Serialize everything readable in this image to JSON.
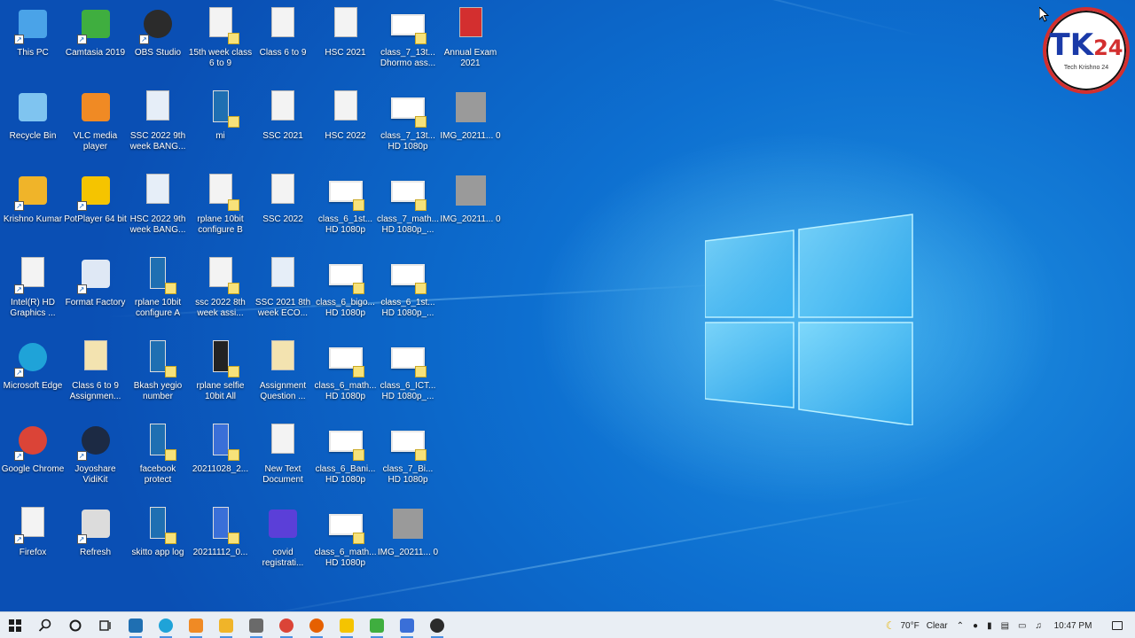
{
  "desktop": {
    "icons": [
      {
        "label": "This PC",
        "icon": "computer-icon",
        "color": "#4aa3e8"
      },
      {
        "label": "Camtasia 2019",
        "icon": "camtasia-icon",
        "color": "#3fae3f"
      },
      {
        "label": "OBS Studio",
        "icon": "obs-icon",
        "color": "#2b2b2b"
      },
      {
        "label": "15th week class 6 to 9",
        "icon": "image-file-icon",
        "color": "#f3f3f3"
      },
      {
        "label": "Class 6 to 9",
        "icon": "blank-file-icon",
        "color": "#f3f3f3"
      },
      {
        "label": "HSC 2021",
        "icon": "blank-file-icon",
        "color": "#f3f3f3"
      },
      {
        "label": "class_7_13t... Dhormo ass...",
        "icon": "video-file-icon",
        "color": "#ffffff"
      },
      {
        "label": "Annual Exam 2021",
        "icon": "pdf-file-icon",
        "color": "#d32f2f"
      },
      {
        "label": "Recycle Bin",
        "icon": "recycle-bin-icon",
        "color": "#7fc4f0"
      },
      {
        "label": "VLC media player",
        "icon": "vlc-icon",
        "color": "#f08a24"
      },
      {
        "label": "SSC 2022 9th week BANG...",
        "icon": "document-icon",
        "color": "#e6eef8"
      },
      {
        "label": "mi",
        "icon": "phone-image-icon",
        "color": "#1f6fb2"
      },
      {
        "label": "SSC 2021",
        "icon": "blank-file-icon",
        "color": "#f3f3f3"
      },
      {
        "label": "HSC 2022",
        "icon": "blank-file-icon",
        "color": "#f3f3f3"
      },
      {
        "label": "class_7_13t... HD 1080p",
        "icon": "video-file-icon",
        "color": "#ffffff"
      },
      {
        "label": "IMG_20211... 0",
        "icon": "photo-icon",
        "color": "#9a9a9a"
      },
      {
        "label": "Krishno Kumar",
        "icon": "user-folder-icon",
        "color": "#f0b429"
      },
      {
        "label": "PotPlayer 64 bit",
        "icon": "potplayer-icon",
        "color": "#f5c400"
      },
      {
        "label": "HSC 2022 9th week BANG...",
        "icon": "document-icon",
        "color": "#e6eef8"
      },
      {
        "label": "rplane 10bit configure B",
        "icon": "image-file-icon",
        "color": "#f3f3f3"
      },
      {
        "label": "SSC 2022",
        "icon": "blank-file-icon",
        "color": "#f3f3f3"
      },
      {
        "label": "class_6_1st... HD 1080p",
        "icon": "video-file-icon",
        "color": "#ffffff"
      },
      {
        "label": "class_7_math... HD 1080p_...",
        "icon": "video-file-icon",
        "color": "#ffffff"
      },
      {
        "label": "IMG_20211... 0",
        "icon": "photo-icon",
        "color": "#9a9a9a"
      },
      {
        "label": "Intel(R) HD Graphics ...",
        "icon": "blank-file-icon",
        "color": "#f3f3f3"
      },
      {
        "label": "Format Factory",
        "icon": "format-factory-icon",
        "color": "#dfe8f5"
      },
      {
        "label": "rplane 10bit configure A",
        "icon": "phone-image-icon",
        "color": "#1f6fb2"
      },
      {
        "label": "ssc 2022 8th week assi...",
        "icon": "image-file-icon",
        "color": "#f3f3f3"
      },
      {
        "label": "SSC 2021 8th week ECO...",
        "icon": "document-icon",
        "color": "#e6eef8"
      },
      {
        "label": "class_6_bigo... HD 1080p",
        "icon": "video-file-icon",
        "color": "#ffffff"
      },
      {
        "label": "class_6_1st... HD 1080p_...",
        "icon": "video-file-icon",
        "color": "#ffffff"
      },
      {
        "label": "Microsoft Edge",
        "icon": "edge-icon",
        "color": "#1fa3d8"
      },
      {
        "label": "Class 6 to 9 Assignmen...",
        "icon": "folder-doc-icon",
        "color": "#f3e3b0"
      },
      {
        "label": "Bkash yegio number",
        "icon": "phone-image-icon",
        "color": "#1f6fb2"
      },
      {
        "label": "rplane selfie 10bit All",
        "icon": "phone-dark-icon",
        "color": "#222222"
      },
      {
        "label": "Assignment Question ...",
        "icon": "folder-doc-icon",
        "color": "#f3e3b0"
      },
      {
        "label": "class_6_math... HD 1080p",
        "icon": "video-file-icon",
        "color": "#ffffff"
      },
      {
        "label": "class_6_ICT... HD 1080p_...",
        "icon": "video-file-icon",
        "color": "#ffffff"
      },
      {
        "label": "Google Chrome",
        "icon": "chrome-icon",
        "color": "#db4437"
      },
      {
        "label": "Joyoshare VidiKit",
        "icon": "vidikit-icon",
        "color": "#1c2a44"
      },
      {
        "label": "facebook protect",
        "icon": "phone-image-icon",
        "color": "#1f6fb2"
      },
      {
        "label": "20211028_2...",
        "icon": "phone-image-icon",
        "color": "#3a6fd8"
      },
      {
        "label": "New Text Document",
        "icon": "blank-file-icon",
        "color": "#f3f3f3"
      },
      {
        "label": "class_6_Bani... HD 1080p",
        "icon": "video-file-icon",
        "color": "#ffffff"
      },
      {
        "label": "class_7_Bi... HD 1080p",
        "icon": "video-file-icon",
        "color": "#ffffff"
      },
      {
        "label": "Firefox",
        "icon": "blank-file-icon",
        "color": "#f3f3f3"
      },
      {
        "label": "Refresh",
        "icon": "refresh-icon",
        "color": "#dcdcdc"
      },
      {
        "label": "skitto app log",
        "icon": "phone-image-icon",
        "color": "#1f6fb2"
      },
      {
        "label": "20211112_0...",
        "icon": "phone-image-icon",
        "color": "#3a6fd8"
      },
      {
        "label": "covid registrati...",
        "icon": "mp4-play-icon",
        "color": "#5b3fd8"
      },
      {
        "label": "class_6_math... HD 1080p",
        "icon": "video-file-icon",
        "color": "#ffffff"
      },
      {
        "label": "IMG_20211... 0",
        "icon": "photo-icon",
        "color": "#9a9a9a"
      }
    ]
  },
  "brand": {
    "name": "TK",
    "number": "24",
    "tagline": "Tech Krishno 24"
  },
  "taskbar": {
    "buttons": [
      {
        "name": "start-button",
        "icon": "windows-start-icon",
        "color": "#1c1c1c"
      },
      {
        "name": "search-button",
        "icon": "search-icon",
        "color": "#1c1c1c"
      },
      {
        "name": "cortana-button",
        "icon": "cortana-circle-icon",
        "color": "#1c1c1c"
      },
      {
        "name": "task-view-button",
        "icon": "task-view-icon",
        "color": "#1c1c1c"
      },
      {
        "name": "taskbar-app-1",
        "icon": "explorer-blue-icon",
        "color": "#1f6fb2"
      },
      {
        "name": "taskbar-app-2",
        "icon": "edge-icon",
        "color": "#1fa3d8"
      },
      {
        "name": "taskbar-app-3",
        "icon": "vlc-icon",
        "color": "#f08a24"
      },
      {
        "name": "taskbar-app-4",
        "icon": "file-explorer-icon",
        "color": "#f0b429"
      },
      {
        "name": "taskbar-app-5",
        "icon": "calculator-icon",
        "color": "#6a6a6a"
      },
      {
        "name": "taskbar-app-6",
        "icon": "chrome-icon",
        "color": "#db4437"
      },
      {
        "name": "taskbar-app-7",
        "icon": "firefox-icon",
        "color": "#e66000"
      },
      {
        "name": "taskbar-app-8",
        "icon": "potplayer-icon",
        "color": "#f5c400"
      },
      {
        "name": "taskbar-app-9",
        "icon": "camtasia-icon",
        "color": "#3fae3f"
      },
      {
        "name": "taskbar-app-10",
        "icon": "photos-icon",
        "color": "#3a6fd8"
      },
      {
        "name": "taskbar-app-11",
        "icon": "obs-icon",
        "color": "#2b2b2b"
      }
    ],
    "weather": {
      "temp": "70°F",
      "condition": "Clear"
    },
    "time": "10:47 PM"
  },
  "colors": {
    "accent": "#0a6fd0",
    "taskbar": "#e9eef4"
  }
}
